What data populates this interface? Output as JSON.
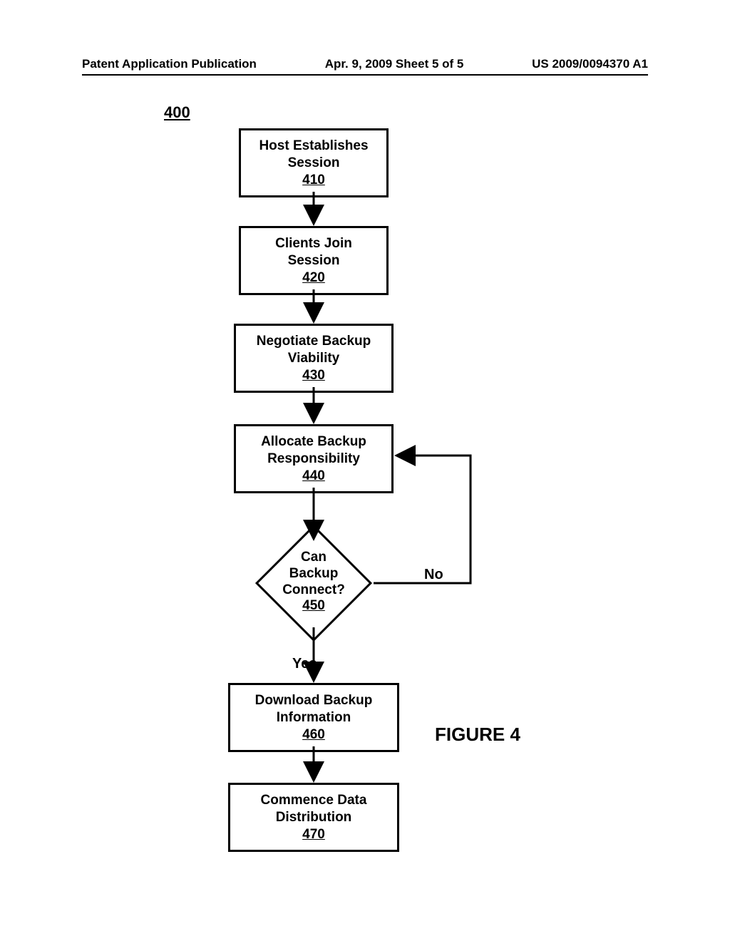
{
  "header": {
    "left": "Patent Application Publication",
    "mid": "Apr. 9, 2009  Sheet 5 of 5",
    "right": "US 2009/0094370 A1"
  },
  "figNum": "400",
  "box410": {
    "t1": "Host Establishes",
    "t2": "Session",
    "ref": "410"
  },
  "box420": {
    "t1": "Clients Join",
    "t2": "Session",
    "ref": "420"
  },
  "box430": {
    "t1": "Negotiate Backup",
    "t2": "Viability",
    "ref": "430"
  },
  "box440": {
    "t1": "Allocate Backup",
    "t2": "Responsibility",
    "ref": "440"
  },
  "diamond450": {
    "t1": "Can",
    "t2": "Backup",
    "t3": "Connect?",
    "ref": "450"
  },
  "labelYes": "Yes",
  "labelNo": "No",
  "box460": {
    "t1": "Download Backup",
    "t2": "Information",
    "ref": "460"
  },
  "box470": {
    "t1": "Commence Data",
    "t2": "Distribution",
    "ref": "470"
  },
  "figureLabel": "FIGURE 4"
}
